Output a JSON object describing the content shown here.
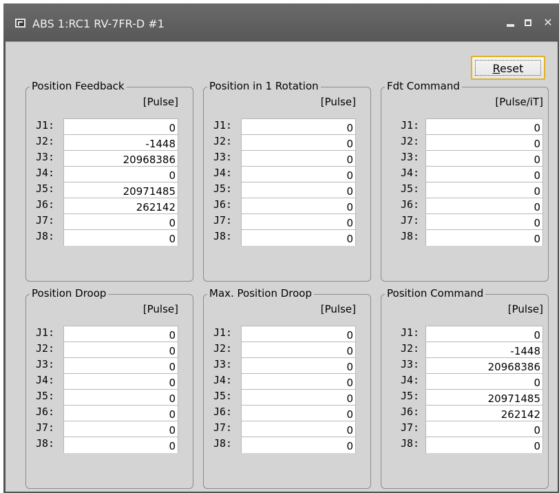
{
  "window": {
    "title": "ABS 1:RC1 RV-7FR-D #1",
    "close_glyph": "✕"
  },
  "reset_button": {
    "label_underlined": "R",
    "label_rest": "eset"
  },
  "groups": [
    {
      "title": "Position Feedback",
      "unit": "[Pulse]",
      "rows": [
        {
          "label": "J1:",
          "value": "0"
        },
        {
          "label": "J2:",
          "value": "-1448"
        },
        {
          "label": "J3:",
          "value": "20968386"
        },
        {
          "label": "J4:",
          "value": "0"
        },
        {
          "label": "J5:",
          "value": "20971485"
        },
        {
          "label": "J6:",
          "value": "262142"
        },
        {
          "label": "J7:",
          "value": "0"
        },
        {
          "label": "J8:",
          "value": "0"
        }
      ]
    },
    {
      "title": "Position in 1 Rotation",
      "unit": "[Pulse]",
      "rows": [
        {
          "label": "J1:",
          "value": "0"
        },
        {
          "label": "J2:",
          "value": "0"
        },
        {
          "label": "J3:",
          "value": "0"
        },
        {
          "label": "J4:",
          "value": "0"
        },
        {
          "label": "J5:",
          "value": "0"
        },
        {
          "label": "J6:",
          "value": "0"
        },
        {
          "label": "J7:",
          "value": "0"
        },
        {
          "label": "J8:",
          "value": "0"
        }
      ]
    },
    {
      "title": "Fdt Command",
      "unit": "[Pulse/iT]",
      "rows": [
        {
          "label": "J1:",
          "value": "0"
        },
        {
          "label": "J2:",
          "value": "0"
        },
        {
          "label": "J3:",
          "value": "0"
        },
        {
          "label": "J4:",
          "value": "0"
        },
        {
          "label": "J5:",
          "value": "0"
        },
        {
          "label": "J6:",
          "value": "0"
        },
        {
          "label": "J7:",
          "value": "0"
        },
        {
          "label": "J8:",
          "value": "0"
        }
      ]
    },
    {
      "title": "Position Droop",
      "unit": "[Pulse]",
      "rows": [
        {
          "label": "J1:",
          "value": "0"
        },
        {
          "label": "J2:",
          "value": "0"
        },
        {
          "label": "J3:",
          "value": "0"
        },
        {
          "label": "J4:",
          "value": "0"
        },
        {
          "label": "J5:",
          "value": "0"
        },
        {
          "label": "J6:",
          "value": "0"
        },
        {
          "label": "J7:",
          "value": "0"
        },
        {
          "label": "J8:",
          "value": "0"
        }
      ]
    },
    {
      "title": "Max. Position Droop",
      "unit": "[Pulse]",
      "rows": [
        {
          "label": "J1:",
          "value": "0"
        },
        {
          "label": "J2:",
          "value": "0"
        },
        {
          "label": "J3:",
          "value": "0"
        },
        {
          "label": "J4:",
          "value": "0"
        },
        {
          "label": "J5:",
          "value": "0"
        },
        {
          "label": "J6:",
          "value": "0"
        },
        {
          "label": "J7:",
          "value": "0"
        },
        {
          "label": "J8:",
          "value": "0"
        }
      ]
    },
    {
      "title": "Position Command",
      "unit": "[Pulse]",
      "rows": [
        {
          "label": "J1:",
          "value": "0"
        },
        {
          "label": "J2:",
          "value": "-1448"
        },
        {
          "label": "J3:",
          "value": "20968386"
        },
        {
          "label": "J4:",
          "value": "0"
        },
        {
          "label": "J5:",
          "value": "20971485"
        },
        {
          "label": "J6:",
          "value": "262142"
        },
        {
          "label": "J7:",
          "value": "0"
        },
        {
          "label": "J8:",
          "value": "0"
        }
      ]
    }
  ]
}
